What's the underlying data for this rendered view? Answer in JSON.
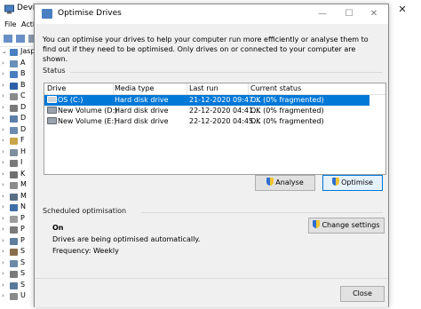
{
  "device_manager": {
    "title": "Device Manager",
    "menu": [
      "File",
      "Actio"
    ],
    "controls": {
      "minimize": "—",
      "maximize": "☐",
      "close": "✕"
    },
    "tree": [
      {
        "label": "Jaspr",
        "color": "#4a7fc1",
        "arrow": "⌄"
      },
      {
        "label": "A",
        "color": "#6a8fb8",
        "arrow": "›"
      },
      {
        "label": "B",
        "color": "#4a7fc1",
        "arrow": "›"
      },
      {
        "label": "B",
        "color": "#2b5fa8",
        "arrow": "›"
      },
      {
        "label": "C",
        "color": "#8a8a8a",
        "arrow": "›"
      },
      {
        "label": "D",
        "color": "#7a7a7a",
        "arrow": "›"
      },
      {
        "label": "D",
        "color": "#5c7fa8",
        "arrow": "›"
      },
      {
        "label": "D",
        "color": "#6d8ab0",
        "arrow": "›"
      },
      {
        "label": "F",
        "color": "#c9a54a",
        "arrow": "›"
      },
      {
        "label": "H",
        "color": "#7d8e9e",
        "arrow": "›"
      },
      {
        "label": "I",
        "color": "#7a7a7a",
        "arrow": "›"
      },
      {
        "label": "K",
        "color": "#6f6f6f",
        "arrow": "›"
      },
      {
        "label": "M",
        "color": "#8c8c8c",
        "arrow": "›"
      },
      {
        "label": "M",
        "color": "#5a6e84",
        "arrow": "›"
      },
      {
        "label": "N",
        "color": "#3f6fa8",
        "arrow": "›"
      },
      {
        "label": "P",
        "color": "#9c9c9c",
        "arrow": "›"
      },
      {
        "label": "P",
        "color": "#7a7a7a",
        "arrow": "›"
      },
      {
        "label": "P",
        "color": "#5f7d9c",
        "arrow": "›"
      },
      {
        "label": "S",
        "color": "#8a6e4a",
        "arrow": "›"
      },
      {
        "label": "S",
        "color": "#6a8aa8",
        "arrow": "›"
      },
      {
        "label": "S",
        "color": "#7a7a7a",
        "arrow": "›"
      },
      {
        "label": "S",
        "color": "#5a7a9a",
        "arrow": "›"
      },
      {
        "label": "U",
        "color": "#8a8a8a",
        "arrow": "›"
      }
    ]
  },
  "optimise_drives": {
    "title": "Optimise Drives",
    "controls": {
      "minimize": "—",
      "maximize": "☐",
      "close": "✕"
    },
    "description": "You can optimise your drives to help your computer run more efficiently or analyse them to find out if they need to be optimised. Only drives on or connected to your computer are shown.",
    "status_label": "Status",
    "columns": [
      "Drive",
      "Media type",
      "Last run",
      "Current status"
    ],
    "drives": [
      {
        "drive": "OS (C:)",
        "media_type": "Hard disk drive",
        "last_run": "21-12-2020 09:47...",
        "status": "OK (0% fragmented)",
        "selected": true
      },
      {
        "drive": "New Volume (D:)",
        "media_type": "Hard disk drive",
        "last_run": "22-12-2020 04:41...",
        "status": "OK (0% fragmented)",
        "selected": false
      },
      {
        "drive": "New Volume (E:)",
        "media_type": "Hard disk drive",
        "last_run": "22-12-2020 04:45...",
        "status": "OK (0% fragmented)",
        "selected": false
      }
    ],
    "analyse_button": "Analyse",
    "optimise_button": "Optimise",
    "scheduled_label": "Scheduled optimisation",
    "schedule_state": "On",
    "schedule_desc": "Drives are being optimised automatically.",
    "frequency": "Frequency: Weekly",
    "change_settings_button": "Change settings",
    "close_button": "Close",
    "accent_color": "#0078d7"
  }
}
